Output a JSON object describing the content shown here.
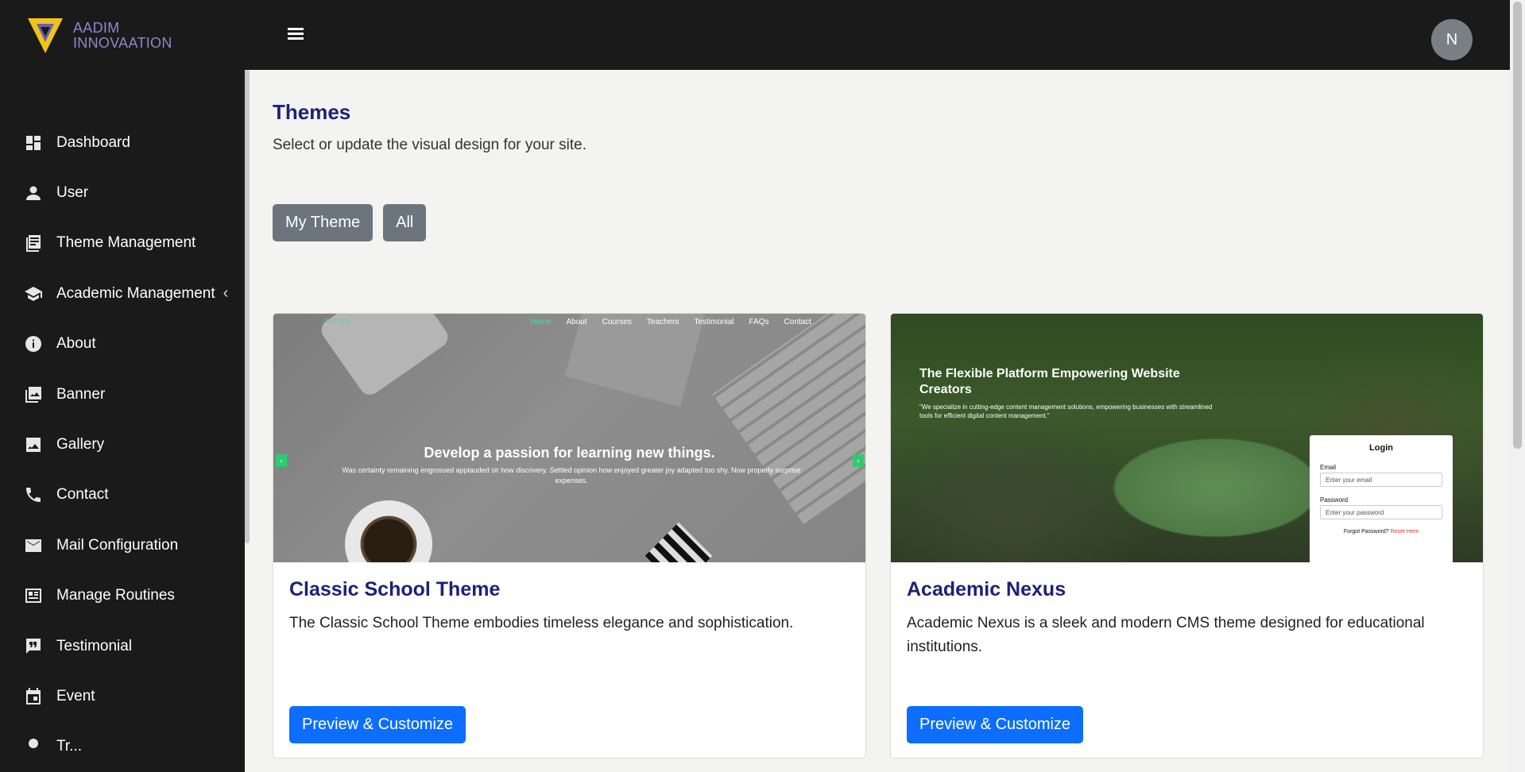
{
  "brand": {
    "line1": "AADIM",
    "line2": "INNOVAATION"
  },
  "user": {
    "avatar_initial": "N"
  },
  "sidebar": {
    "items": [
      {
        "label": "Dashboard",
        "icon": "dashboard-icon"
      },
      {
        "label": "User",
        "icon": "user-icon"
      },
      {
        "label": "Theme Management",
        "icon": "theme-icon"
      },
      {
        "label": "Academic Management",
        "icon": "school-icon",
        "chevron": "‹"
      },
      {
        "label": "About",
        "icon": "info-icon"
      },
      {
        "label": "Banner",
        "icon": "banner-icon"
      },
      {
        "label": "Gallery",
        "icon": "gallery-icon"
      },
      {
        "label": "Contact",
        "icon": "phone-icon"
      },
      {
        "label": "Mail Configuration",
        "icon": "mail-icon"
      },
      {
        "label": "Manage Routines",
        "icon": "routine-icon"
      },
      {
        "label": "Testimonial",
        "icon": "testimonial-icon"
      },
      {
        "label": "Event",
        "icon": "event-icon"
      },
      {
        "label": "Tr...",
        "icon": "tree-icon"
      }
    ]
  },
  "page": {
    "title": "Themes",
    "subtitle": "Select or update the visual design for your site.",
    "filters": [
      "My Theme",
      "All"
    ]
  },
  "themes": [
    {
      "title": "Classic School Theme",
      "description": "The Classic School Theme embodies timeless elegance and sophistication.",
      "button": "Preview & Customize",
      "preview": {
        "logo": "SCH OOL",
        "nav": [
          "Home",
          "About",
          "Courses",
          "Teachers",
          "Testimonial",
          "FAQs",
          "Contact"
        ],
        "headline": "Develop a passion for learning new things.",
        "text": "Was certainty remaining engrossed applauded sir how discovery. Settled opinion how enjoyed greater joy adapted too shy. Now properly surprise expenses.",
        "prev_arrow": "‹",
        "next_arrow": "›"
      }
    },
    {
      "title": "Academic Nexus",
      "description": "Academic Nexus is a sleek and modern CMS theme designed for educational institutions.",
      "button": "Preview & Customize",
      "preview": {
        "headline": "The Flexible Platform Empowering Website Creators",
        "text": "\"We specialize in cutting-edge content management solutions, empowering businesses with streamlined tools for efficient digital content management.\"",
        "login_title": "Login",
        "email_label": "Email",
        "email_placeholder": "Enter your email",
        "password_label": "Password",
        "password_placeholder": "Enter your password",
        "forgot_text": "Forgot Password?",
        "reset_text": "Reset Here"
      }
    }
  ],
  "colors": {
    "accent": "#0d6efd",
    "title": "#1e2176",
    "sidebar": "#1a1a1a",
    "filter": "#6c757d"
  }
}
